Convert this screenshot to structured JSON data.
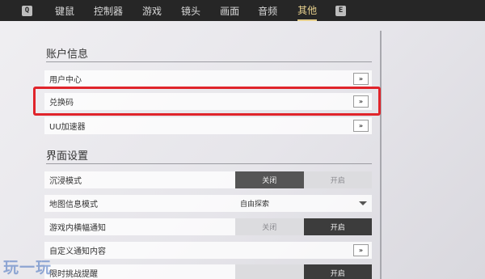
{
  "nav": {
    "left_key": "Q",
    "right_key": "E",
    "tabs": [
      "键鼠",
      "控制器",
      "游戏",
      "镜头",
      "画面",
      "音频",
      "其他"
    ],
    "active_tab": "其他"
  },
  "account": {
    "title": "账户信息",
    "rows": [
      {
        "label": "用户中心",
        "button": "»"
      },
      {
        "label": "兑换码",
        "button": "»"
      },
      {
        "label": "UU加速器",
        "button": "»"
      }
    ]
  },
  "interface": {
    "title": "界面设置",
    "immersive": {
      "label": "沉浸模式",
      "off": "关闭",
      "on": "开启",
      "value": "关闭"
    },
    "map_info": {
      "label": "地图信息模式",
      "value": "自由探索"
    },
    "banner": {
      "label": "游戏内横幅通知",
      "off": "关闭",
      "on": "开启",
      "value": "开启"
    },
    "custom_notify": {
      "label": "自定义通知内容",
      "button": "»"
    },
    "reminder": {
      "label": "限时挑战提醒",
      "on": "开启",
      "value": "开启"
    }
  },
  "watermark": "玩一玩",
  "colors": {
    "accent_tab": "#e6cf8c",
    "highlight": "#e0242b"
  }
}
